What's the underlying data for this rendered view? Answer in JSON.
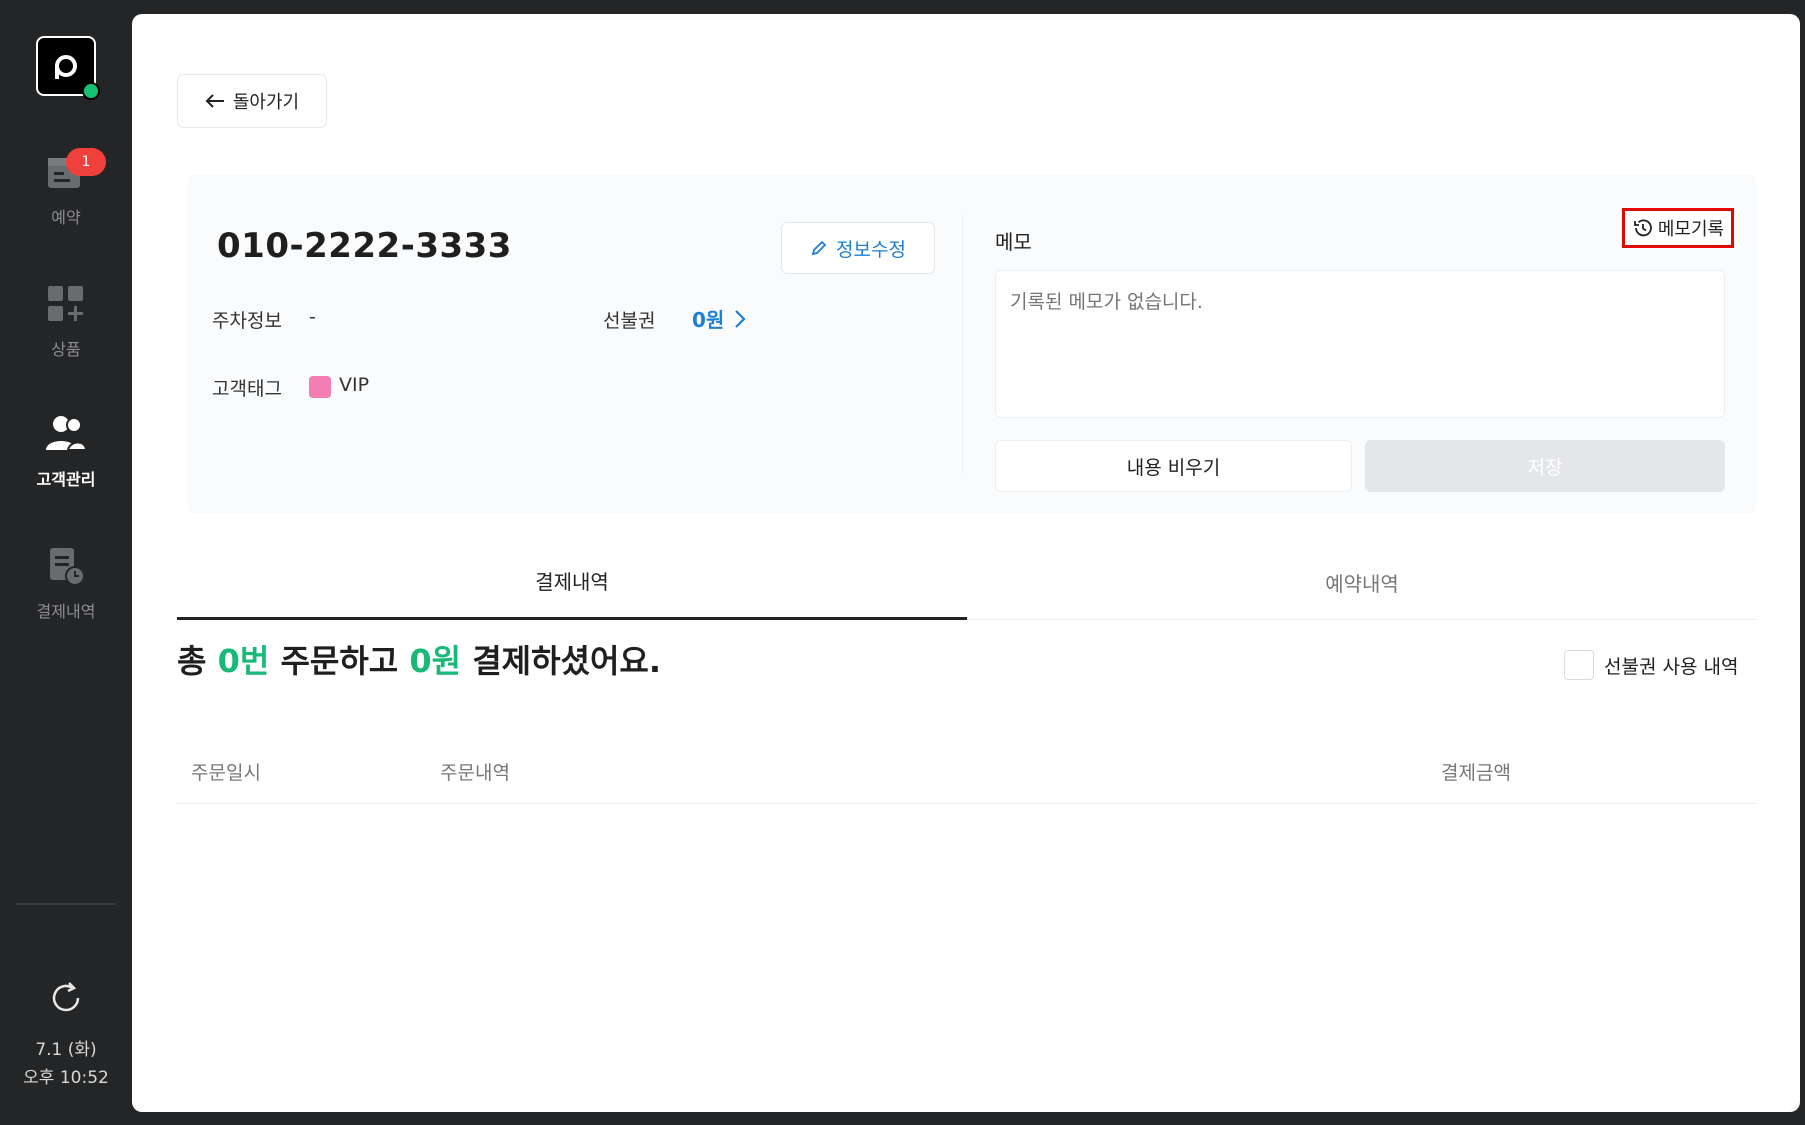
{
  "sidebar": {
    "badge_count": "1",
    "items": [
      {
        "label": "예약",
        "icon": "calendar-icon"
      },
      {
        "label": "상품",
        "icon": "grid-plus-icon"
      },
      {
        "label": "고객관리",
        "icon": "users-icon"
      },
      {
        "label": "결제내역",
        "icon": "receipt-clock-icon"
      }
    ],
    "clock_date": "7.1 (화)",
    "clock_time": "오후 10:52"
  },
  "header": {
    "back_label": "돌아가기"
  },
  "customer": {
    "phone": "010-2222-3333",
    "edit_label": "정보수정",
    "parking_label": "주차정보",
    "parking_value": "-",
    "prepaid_label": "선불권",
    "prepaid_value": "0원",
    "tag_label": "고객태그",
    "tag_value": "VIP",
    "tag_color": "#f47eb3"
  },
  "memo": {
    "title": "메모",
    "history_label": "메모기록",
    "placeholder": "기록된 메모가 없습니다.",
    "clear_label": "내용 비우기",
    "save_label": "저장"
  },
  "tabs": [
    {
      "label": "결제내역",
      "active": true
    },
    {
      "label": "예약내역",
      "active": false
    }
  ],
  "summary": {
    "prefix": "총",
    "order_count": "0번",
    "middle": "주문하고",
    "amount": "0원",
    "suffix": "결제하셨어요."
  },
  "filter": {
    "prepaid_usage_label": "선불권 사용 내역",
    "checked": false
  },
  "table": {
    "columns": [
      "주문일시",
      "주문내역",
      "결제금액"
    ]
  },
  "colors": {
    "accent_blue": "#1d7fd6",
    "accent_green": "#19b978",
    "badge_red": "#f0403c",
    "highlight_box": "#e10600"
  }
}
